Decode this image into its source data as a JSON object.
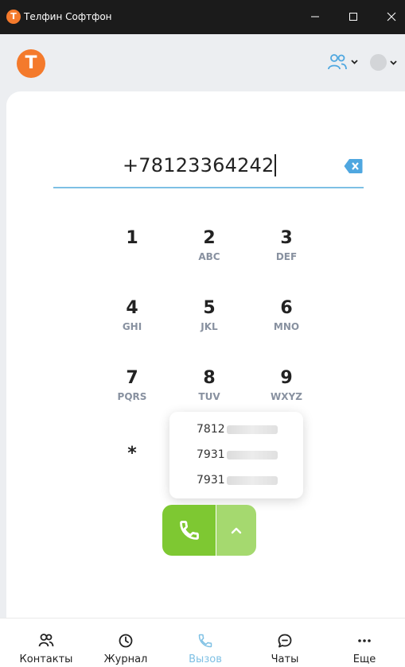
{
  "window": {
    "title": "Телфин Софтфон",
    "app_icon_letter": "T"
  },
  "header": {
    "logo_letter": "T"
  },
  "dialer": {
    "number": "+78123364242"
  },
  "keypad": [
    {
      "digit": "1",
      "letters": ""
    },
    {
      "digit": "2",
      "letters": "ABC"
    },
    {
      "digit": "3",
      "letters": "DEF"
    },
    {
      "digit": "4",
      "letters": "GHI"
    },
    {
      "digit": "5",
      "letters": "JKL"
    },
    {
      "digit": "6",
      "letters": "MNO"
    },
    {
      "digit": "7",
      "letters": "PQRS"
    },
    {
      "digit": "8",
      "letters": "TUV"
    },
    {
      "digit": "9",
      "letters": "WXYZ"
    },
    {
      "digit": "*",
      "letters": ""
    }
  ],
  "suggestions": [
    {
      "prefix": "7812"
    },
    {
      "prefix": "7931"
    },
    {
      "prefix": "7931"
    }
  ],
  "nav": {
    "contacts": "Контакты",
    "journal": "Журнал",
    "call": "Вызов",
    "chats": "Чаты",
    "more": "Еще"
  },
  "colors": {
    "brand_orange": "#f47a2c",
    "call_green": "#7ec832",
    "call_green_light": "#a5d96f",
    "accent_blue": "#7ec0e4",
    "backspace_blue": "#4fa7e0"
  }
}
